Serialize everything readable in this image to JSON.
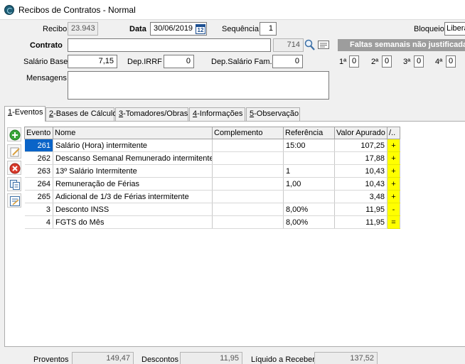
{
  "window": {
    "title": "Recibos de Contratos - Normal"
  },
  "header": {
    "recibo_label": "Recibo",
    "recibo_value": "23.943",
    "data_label": "Data",
    "data_value": "30/06/2019",
    "cal_day": "12",
    "sequencia_label": "Sequência",
    "sequencia_value": "1",
    "bloqueio_label": "Bloqueio",
    "bloqueio_value": "Liberado",
    "contrato_label": "Contrato",
    "contrato_value": "",
    "contrato_code": "714",
    "faltas_banner": "Faltas semanais não justificadas",
    "salario_label": "Salário Base",
    "salario_value": "7,15",
    "depirrf_label": "Dep.IRRF",
    "depirrf_value": "0",
    "depsalfam_label": "Dep.Salário Fam.",
    "depsalfam_value": "0",
    "semanas": [
      {
        "label": "1ª",
        "value": "0"
      },
      {
        "label": "2ª",
        "value": "0"
      },
      {
        "label": "3ª",
        "value": "0"
      },
      {
        "label": "4ª",
        "value": "0"
      }
    ],
    "mensagens_label": "Mensagens",
    "mensagens_value": ""
  },
  "tabs": [
    {
      "key": "1",
      "label": "-Eventos"
    },
    {
      "key": "2",
      "label": "-Bases de Cálculo"
    },
    {
      "key": "3",
      "label": "-Tomadores/Obras"
    },
    {
      "key": "4",
      "label": "-Informações"
    },
    {
      "key": "5",
      "label": "-Observação"
    }
  ],
  "toolbar_icons": [
    "add-icon",
    "edit-icon",
    "delete-icon",
    "copy-icon",
    "notes-icon"
  ],
  "grid": {
    "columns": [
      "Evento",
      "Nome",
      "Complemento",
      "Referência",
      "Valor Apurado",
      "/.."
    ],
    "rows": [
      {
        "evento": "261",
        "nome": "Salário (Hora) intermitente",
        "complemento": "",
        "referencia": "15:00",
        "valor": "107,25",
        "sinal": "+"
      },
      {
        "evento": "262",
        "nome": "Descanso Semanal Remunerado intermitente",
        "complemento": "",
        "referencia": "",
        "valor": "17,88",
        "sinal": "+"
      },
      {
        "evento": "263",
        "nome": "13º Salário Intermitente",
        "complemento": "",
        "referencia": "1",
        "valor": "10,43",
        "sinal": "+"
      },
      {
        "evento": "264",
        "nome": "Remuneração de Férias",
        "complemento": "",
        "referencia": "1,00",
        "valor": "10,43",
        "sinal": "+"
      },
      {
        "evento": "265",
        "nome": "Adicional de 1/3 de Férias intermitente",
        "complemento": "",
        "referencia": "",
        "valor": "3,48",
        "sinal": "+"
      },
      {
        "evento": "3",
        "nome": "Desconto INSS",
        "complemento": "",
        "referencia": "8,00%",
        "valor": "11,95",
        "sinal": "-"
      },
      {
        "evento": "4",
        "nome": "FGTS do Mês",
        "complemento": "",
        "referencia": "8,00%",
        "valor": "11,95",
        "sinal": "="
      }
    ]
  },
  "footer": {
    "proventos_label": "Proventos",
    "proventos_value": "149,47",
    "descontos_label": "Descontos",
    "descontos_value": "11,95",
    "liquido_label": "Líquido a Receber",
    "liquido_value": "137,52"
  },
  "colors": {
    "selection": "#0a64c8",
    "flag": "#ffff00",
    "banner": "#9d9d9d"
  }
}
